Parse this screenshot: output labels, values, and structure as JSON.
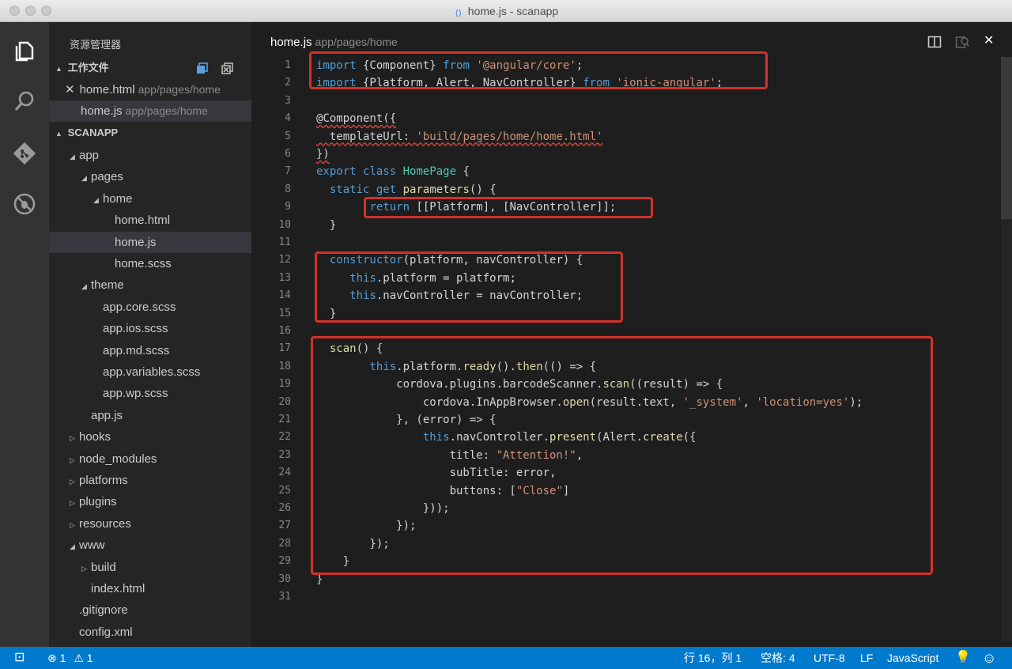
{
  "window": {
    "title": "home.js - scanapp"
  },
  "sidebar": {
    "title": "资源管理器",
    "working_files_label": "工作文件",
    "working_files": [
      {
        "name": "home.html",
        "path": "app/pages/home",
        "closable": true
      },
      {
        "name": "home.js",
        "path": "app/pages/home",
        "closable": false
      }
    ],
    "project_label": "SCANAPP",
    "tree": [
      {
        "label": "app",
        "twisty": "▲",
        "depth": 1
      },
      {
        "label": "pages",
        "twisty": "▲",
        "depth": 2
      },
      {
        "label": "home",
        "twisty": "▲",
        "depth": 3
      },
      {
        "label": "home.html",
        "twisty": "",
        "depth": 4
      },
      {
        "label": "home.js",
        "twisty": "",
        "depth": 4
      },
      {
        "label": "home.scss",
        "twisty": "",
        "depth": 4
      },
      {
        "label": "theme",
        "twisty": "▲",
        "depth": 2
      },
      {
        "label": "app.core.scss",
        "twisty": "",
        "depth": 3
      },
      {
        "label": "app.ios.scss",
        "twisty": "",
        "depth": 3
      },
      {
        "label": "app.md.scss",
        "twisty": "",
        "depth": 3
      },
      {
        "label": "app.variables.scss",
        "twisty": "",
        "depth": 3
      },
      {
        "label": "app.wp.scss",
        "twisty": "",
        "depth": 3
      },
      {
        "label": "app.js",
        "twisty": "",
        "depth": 2
      },
      {
        "label": "hooks",
        "twisty": "▶",
        "depth": 1
      },
      {
        "label": "node_modules",
        "twisty": "▶",
        "depth": 1
      },
      {
        "label": "platforms",
        "twisty": "▶",
        "depth": 1
      },
      {
        "label": "plugins",
        "twisty": "▶",
        "depth": 1
      },
      {
        "label": "resources",
        "twisty": "▶",
        "depth": 1
      },
      {
        "label": "www",
        "twisty": "▲",
        "depth": 1
      },
      {
        "label": "build",
        "twisty": "▶",
        "depth": 2
      },
      {
        "label": "index.html",
        "twisty": "",
        "depth": 2
      },
      {
        "label": ".gitignore",
        "twisty": "",
        "depth": 1
      },
      {
        "label": "config.xml",
        "twisty": "",
        "depth": 1
      }
    ],
    "selected_tree_item": "home.js"
  },
  "editor": {
    "tab_name": "home.js",
    "tab_path": "app/pages/home",
    "highlighted_line_ranges": [
      [
        1,
        2
      ],
      [
        9,
        9
      ],
      [
        12,
        15
      ],
      [
        17,
        29
      ]
    ],
    "code_lines": [
      "import {Component} from '@angular/core';",
      "import {Platform, Alert, NavController} from 'ionic-angular';",
      "",
      "@Component({",
      "  templateUrl: 'build/pages/home/home.html'",
      "})",
      "export class HomePage {",
      "  static get parameters() {",
      "        return [[Platform], [NavController]];",
      "  }",
      "",
      "  constructor(platform, navController) {",
      "     this.platform = platform;",
      "     this.navController = navController;",
      "  }",
      "",
      "  scan() {",
      "        this.platform.ready().then(() => {",
      "            cordova.plugins.barcodeScanner.scan((result) => {",
      "                cordova.InAppBrowser.open(result.text, '_system', 'location=yes');",
      "            }, (error) => {",
      "                this.navController.present(Alert.create({",
      "                    title: \"Attention!\",",
      "                    subTitle: error,",
      "                    buttons: [\"Close\"]",
      "                }));",
      "            });",
      "        });",
      "    }",
      "}",
      ""
    ]
  },
  "statusbar": {
    "errors": "1",
    "warnings": "1",
    "position": "行 16，列 1",
    "indent": "空格: 4",
    "encoding": "UTF-8",
    "eol": "LF",
    "language": "JavaScript"
  },
  "colors": {
    "accent": "#007acc",
    "highlight_box": "#d3312b"
  }
}
